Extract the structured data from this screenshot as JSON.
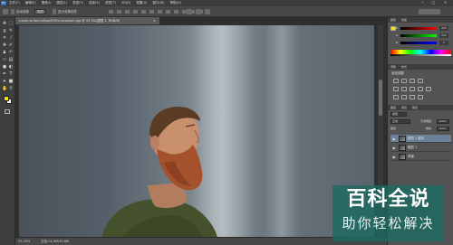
{
  "app": {
    "logo": "Ps"
  },
  "menu": {
    "items": [
      "文件(F)",
      "编辑(E)",
      "图像(I)",
      "图层(L)",
      "类型(Y)",
      "选择(S)",
      "滤镜(T)",
      "3D(D)",
      "视图(V)",
      "窗口(W)",
      "帮助(H)"
    ]
  },
  "window_controls": {
    "minimize": "−",
    "maximize": "□",
    "close": "×"
  },
  "options": {
    "auto_select_label": "自动选择",
    "auto_select_value": "图层",
    "transform_label": "显示变换控件"
  },
  "document": {
    "tab_title": "Lukas-writes-hd0oqSO5hI-unsplash.jpg @ 33.3%(图层 1, RGB/8)",
    "tab_close": "×",
    "zoom": "33.33%",
    "doc_info": "文档:24.9M/49.8M"
  },
  "color_panel": {
    "tabs": [
      "颜色",
      "色板"
    ],
    "sliders": [
      {
        "label": "R",
        "value": "255",
        "gradient": [
          "#000000",
          "#ff0000"
        ]
      },
      {
        "label": "G",
        "value": "241",
        "gradient": [
          "#000000",
          "#00ff00"
        ]
      },
      {
        "label": "B",
        "value": "0",
        "gradient": [
          "#000000",
          "#0000ff"
        ]
      }
    ]
  },
  "adjustments_panel": {
    "tabs": [
      "调整",
      "样式"
    ],
    "title": "添加调整"
  },
  "layers_panel": {
    "tabs": [
      "图层",
      "通道",
      "路径"
    ],
    "kind_filter": "类型",
    "blend_mode": "正常",
    "opacity_label": "不透明度:",
    "opacity_value": "100%",
    "lock_label": "锁定:",
    "fill_label": "填充:",
    "fill_value": "100%",
    "layers": [
      {
        "name": "图层 1 副本"
      },
      {
        "name": "图层 1"
      },
      {
        "name": "背景"
      }
    ]
  },
  "colors": {
    "foreground": "#f5e300",
    "background": "#ffffff"
  },
  "watermark": {
    "line1": "百科全说",
    "line2": "助你轻松解决"
  }
}
